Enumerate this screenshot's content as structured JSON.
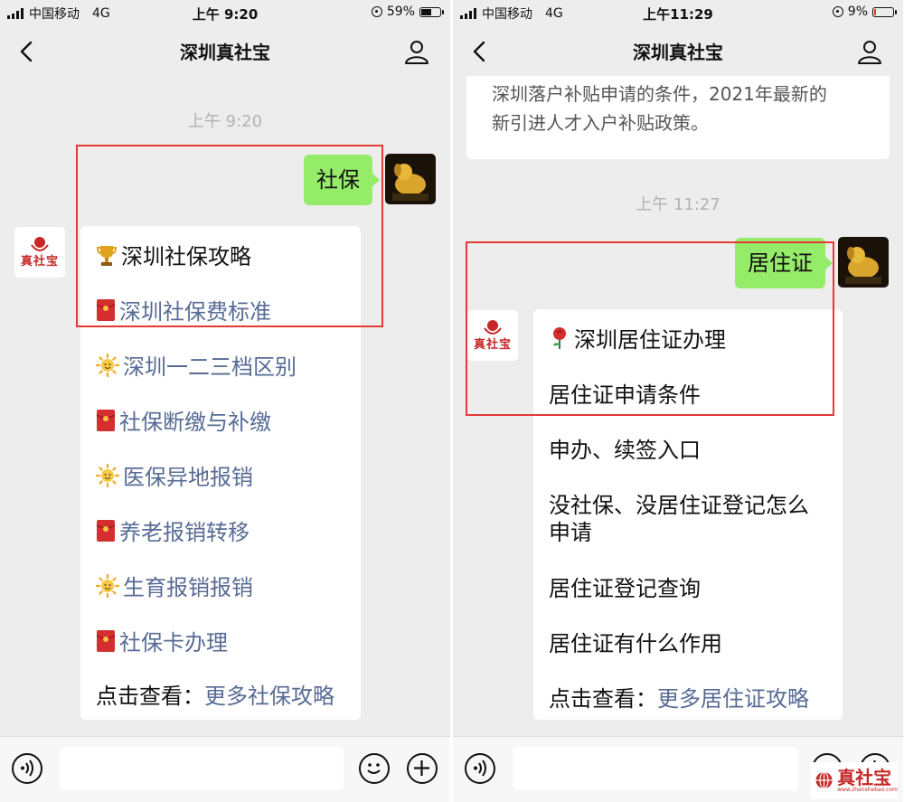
{
  "left": {
    "status": {
      "carrier": "中国移动",
      "network": "4G",
      "time": "上午 9:20",
      "battery": "59%",
      "battery_level": 0.59
    },
    "nav": {
      "title": "深圳真社宝"
    },
    "time_label": "上午 9:20",
    "sent_message": "社保",
    "bot_name": "真社宝",
    "menu": [
      {
        "icon": "trophy-icon",
        "text": "深圳社保攻略",
        "link": false
      },
      {
        "icon": "red-envelope-icon",
        "text": "深圳社保费标准",
        "link": true
      },
      {
        "icon": "sun-icon",
        "text": "深圳一二三档区别",
        "link": true
      },
      {
        "icon": "red-envelope-icon",
        "text": "社保断缴与补缴",
        "link": true
      },
      {
        "icon": "sun-icon",
        "text": "医保异地报销",
        "link": true
      },
      {
        "icon": "red-envelope-icon",
        "text": "养老报销转移",
        "link": true
      },
      {
        "icon": "sun-icon",
        "text": "生育报销报销",
        "link": true
      },
      {
        "icon": "red-envelope-icon",
        "text": "社保卡办理",
        "link": true
      }
    ],
    "footer_prefix": "点击查看：",
    "footer_link": "更多社保攻略"
  },
  "right": {
    "status": {
      "carrier": "中国移动",
      "network": "4G",
      "time": "上午11:29",
      "battery": "9%",
      "battery_level": 0.09
    },
    "nav": {
      "title": "深圳真社宝"
    },
    "prev_text_line1": "深圳落户补贴申请的条件，2021年最新的",
    "prev_text_line2": "新引进人才入户补贴政策。",
    "time_label": "上午 11:27",
    "sent_message": "居住证",
    "bot_name": "真社宝",
    "card_title": "深圳居住证办理",
    "title_icon": "rose-icon",
    "links": [
      "居住证申请条件",
      "申办、续签入口",
      "没社保、没居住证登记怎么",
      "申请",
      "居住证登记查询",
      "居住证有什么作用"
    ],
    "footer_prefix": "点击查看：",
    "footer_link": "更多居住证攻略"
  },
  "watermark": {
    "name": "真社宝",
    "domain": "www.zhenshebao.com"
  },
  "colors": {
    "chat_bg": "#ededed",
    "sent_bubble": "#95ec69",
    "link": "#576b95",
    "highlight": "#e53935"
  }
}
